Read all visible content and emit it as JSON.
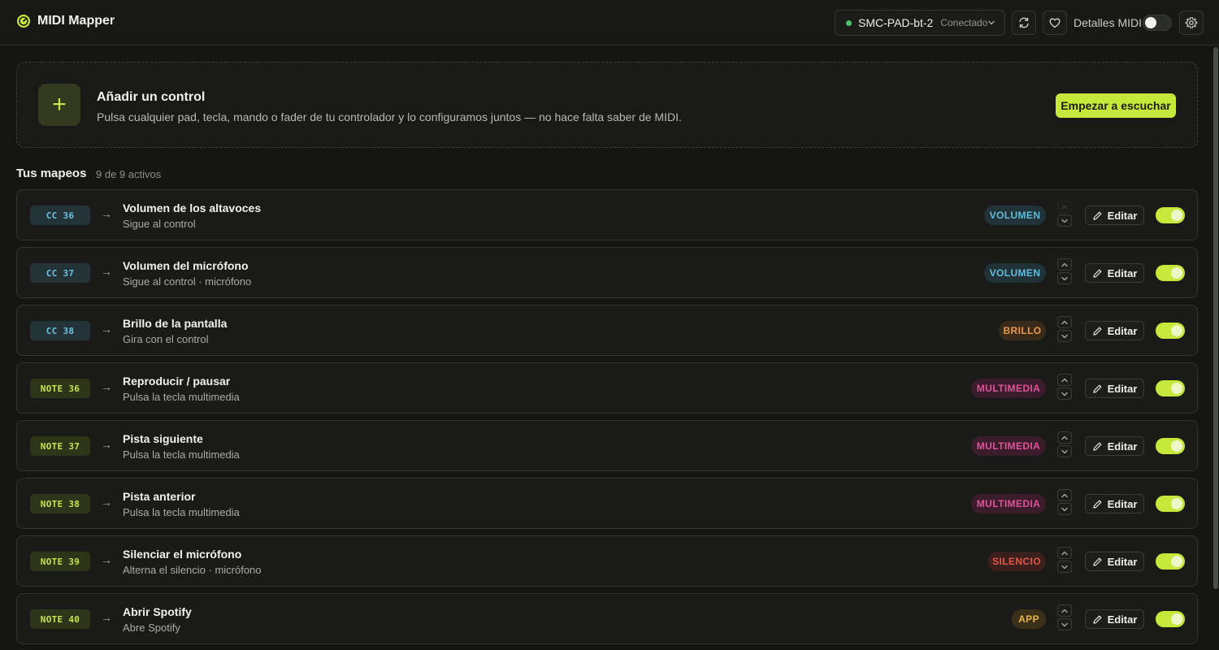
{
  "app": {
    "title": "MIDI Mapper"
  },
  "header": {
    "device_name": "SMC-PAD-bt-2",
    "device_status": "Conectado",
    "midi_details_label": "Detalles MIDI",
    "midi_details_enabled": false
  },
  "add_control": {
    "title": "Añadir un control",
    "description": "Pulsa cualquier pad, tecla, mando o fader de tu controlador y lo configuramos juntos — no hace falta saber de MIDI.",
    "button_label": "Empezar a escuchar"
  },
  "mappings": {
    "title": "Tus mapeos",
    "count_label": "9 de 9 activos",
    "edit_label": "Editar",
    "arrow": "→",
    "items": [
      {
        "tag": "CC 36",
        "tag_kind": "cc",
        "title": "Volumen de los altavoces",
        "subtitle": "Sigue al control",
        "badge": "VOLUMEN",
        "badge_kind": "vol",
        "enabled": true
      },
      {
        "tag": "CC 37",
        "tag_kind": "cc",
        "title": "Volumen del micrófono",
        "subtitle": "Sigue al control · micrófono",
        "badge": "VOLUMEN",
        "badge_kind": "vol",
        "enabled": true
      },
      {
        "tag": "CC 38",
        "tag_kind": "cc",
        "title": "Brillo de la pantalla",
        "subtitle": "Gira con el control",
        "badge": "BRILLO",
        "badge_kind": "bri",
        "enabled": true
      },
      {
        "tag": "NOTE 36",
        "tag_kind": "note",
        "title": "Reproducir / pausar",
        "subtitle": "Pulsa la tecla multimedia",
        "badge": "MULTIMEDIA",
        "badge_kind": "mul",
        "enabled": true
      },
      {
        "tag": "NOTE 37",
        "tag_kind": "note",
        "title": "Pista siguiente",
        "subtitle": "Pulsa la tecla multimedia",
        "badge": "MULTIMEDIA",
        "badge_kind": "mul",
        "enabled": true
      },
      {
        "tag": "NOTE 38",
        "tag_kind": "note",
        "title": "Pista anterior",
        "subtitle": "Pulsa la tecla multimedia",
        "badge": "MULTIMEDIA",
        "badge_kind": "mul",
        "enabled": true
      },
      {
        "tag": "NOTE 39",
        "tag_kind": "note",
        "title": "Silenciar el micrófono",
        "subtitle": "Alterna el silencio · micrófono",
        "badge": "SILENCIO",
        "badge_kind": "sil",
        "enabled": true
      },
      {
        "tag": "NOTE 40",
        "tag_kind": "note",
        "title": "Abrir Spotify",
        "subtitle": "Abre Spotify",
        "badge": "APP",
        "badge_kind": "app",
        "enabled": true
      }
    ]
  },
  "colors": {
    "accent": "#c6e83a",
    "connected": "#48c46a",
    "volume": "#62bddb",
    "brightness": "#e79a4c",
    "multimedia": "#e1529a",
    "mute": "#e2584b",
    "app": "#e6b13e"
  }
}
